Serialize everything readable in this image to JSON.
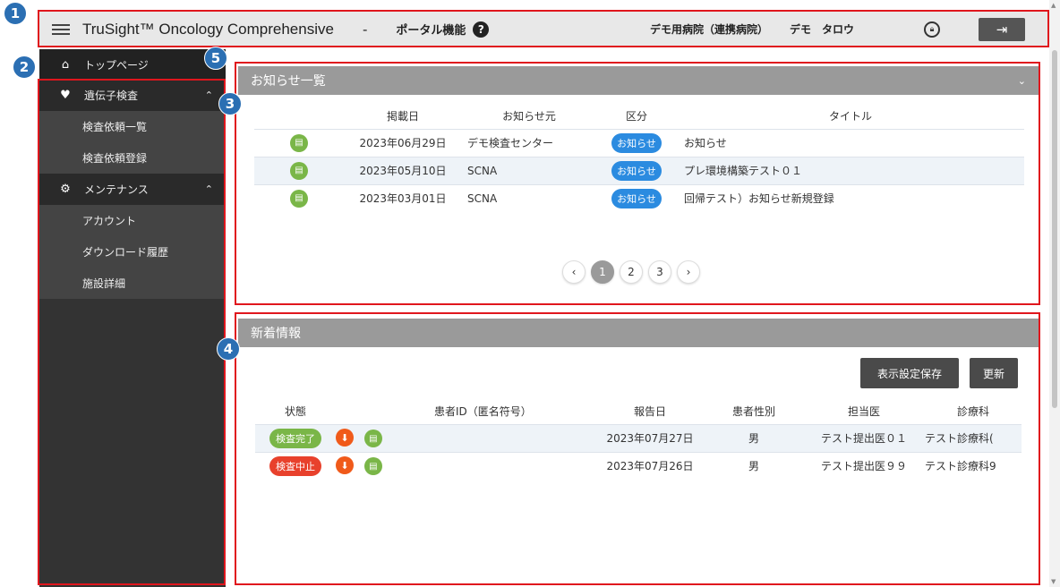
{
  "header": {
    "app_title": "TruSight™ Oncology Comprehensive",
    "separator": "-",
    "portal_label": "ポータル機能",
    "help_glyph": "?",
    "hospital": "デモ用病院（連携病院）",
    "user_name": "デモ　タロウ",
    "lock_icon": "lock-icon",
    "logout_icon": "logout-icon"
  },
  "annotations": [
    "1",
    "2",
    "3",
    "4",
    "5"
  ],
  "sidebar": {
    "home_label": "トップページ",
    "groups": [
      {
        "label": "遺伝子検査",
        "icon": "heart-icon",
        "items": [
          "検査依頼一覧",
          "検査依頼登録"
        ]
      },
      {
        "label": "メンテナンス",
        "icon": "gear-icon",
        "items": [
          "アカウント",
          "ダウンロード履歴",
          "施設詳細"
        ]
      }
    ]
  },
  "notices": {
    "title": "お知らせ一覧",
    "columns": [
      "掲載日",
      "お知らせ元",
      "区分",
      "タイトル"
    ],
    "rows": [
      {
        "date": "2023年06月29日",
        "source": "デモ検査センター",
        "category": "お知らせ",
        "title": "お知らせ"
      },
      {
        "date": "2023年05月10日",
        "source": "SCNA",
        "category": "お知らせ",
        "title": "プレ環境構築テスト０１"
      },
      {
        "date": "2023年03月01日",
        "source": "SCNA",
        "category": "お知らせ",
        "title": "回帰テスト）お知らせ新規登録"
      }
    ],
    "doc_glyph": "▤",
    "pagination": {
      "prev": "‹",
      "pages": [
        "1",
        "2",
        "3"
      ],
      "current": "1",
      "next": "›"
    }
  },
  "news": {
    "title": "新着情報",
    "save_label": "表示設定保存",
    "refresh_label": "更新",
    "columns": [
      "状態",
      "患者ID（匿名符号）",
      "報告日",
      "患者性別",
      "担当医",
      "診療科"
    ],
    "rows": [
      {
        "status": "検査完了",
        "status_color": "#7ab648",
        "patient_id": "",
        "date": "2023年07月27日",
        "sex": "男",
        "doctor": "テスト提出医０１",
        "dept": "テスト診療科("
      },
      {
        "status": "検査中止",
        "status_color": "#e8412c",
        "patient_id": "",
        "date": "2023年07月26日",
        "sex": "男",
        "doctor": "テスト提出医９９",
        "dept": "テスト診療科9"
      }
    ],
    "download_glyph": "⬇",
    "doc_glyph": "▤"
  },
  "colors": {
    "accent_blue": "#2b8be0",
    "badge_blue": "#2b6fb3",
    "annotation_red": "#e0161d",
    "sidebar_bg": "#333333",
    "panel_header": "#9a9a9a",
    "status_complete": "#7ab648",
    "status_aborted": "#e8412c",
    "download": "#f05a1a"
  }
}
